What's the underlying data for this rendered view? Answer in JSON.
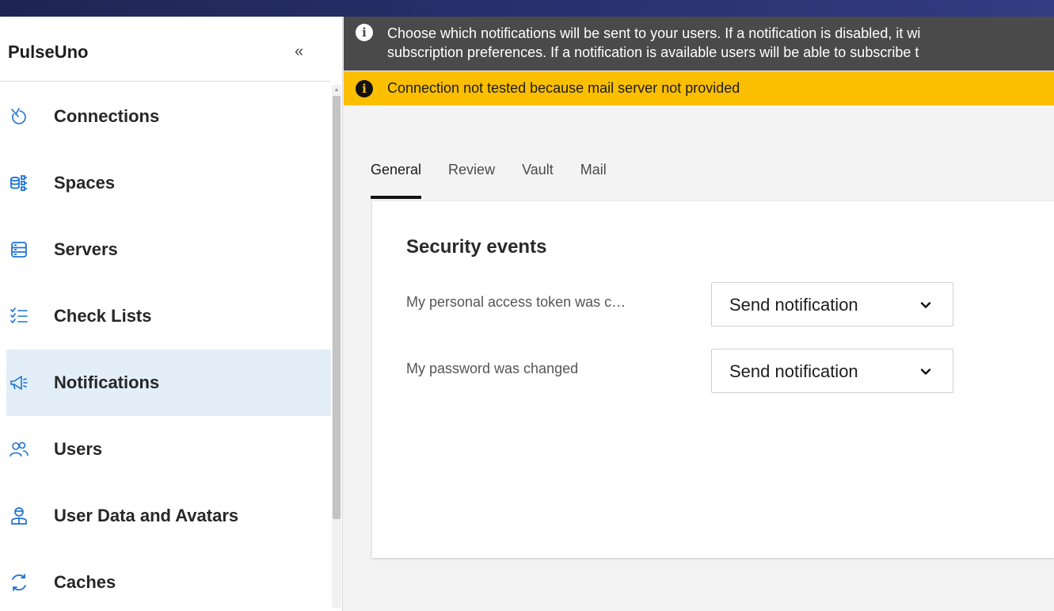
{
  "app": {
    "name": "PulseUno",
    "collapse_glyph": "«"
  },
  "sidebar": {
    "items": [
      {
        "label": "Connections",
        "icon": "connections-icon",
        "active": false
      },
      {
        "label": "Spaces",
        "icon": "spaces-icon",
        "active": false
      },
      {
        "label": "Servers",
        "icon": "servers-icon",
        "active": false
      },
      {
        "label": "Check Lists",
        "icon": "checklist-icon",
        "active": false
      },
      {
        "label": "Notifications",
        "icon": "megaphone-icon",
        "active": true
      },
      {
        "label": "Users",
        "icon": "users-icon",
        "active": false
      },
      {
        "label": "User Data and Avatars",
        "icon": "user-badge-icon",
        "active": false
      },
      {
        "label": "Caches",
        "icon": "refresh-icon",
        "active": false
      }
    ]
  },
  "banners": {
    "info": {
      "line1": "Choose which notifications will be sent to your users. If a notification is disabled, it wi",
      "line2": "subscription preferences. If a notification is available users will be able to subscribe t"
    },
    "warning": "Connection not tested because mail server not provided",
    "icon_glyph": "i"
  },
  "tabs": [
    {
      "label": "General",
      "active": true
    },
    {
      "label": "Review",
      "active": false
    },
    {
      "label": "Vault",
      "active": false
    },
    {
      "label": "Mail",
      "active": false
    }
  ],
  "section": {
    "title": "Security events",
    "rows": [
      {
        "label": "My personal access token was c…",
        "value": "Send notification"
      },
      {
        "label": "My password was changed",
        "value": "Send notification"
      }
    ]
  },
  "colors": {
    "accent": "#1d73d4",
    "active_bg": "#e3eef9",
    "warning": "#fbbf00",
    "info_bg": "#4a4a4a"
  }
}
